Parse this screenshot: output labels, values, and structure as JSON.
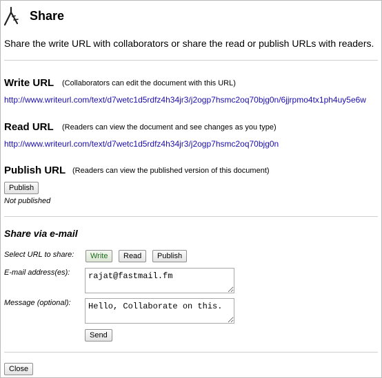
{
  "dialog": {
    "title": "Share",
    "intro": "Share the write URL with collaborators or share the read or publish URLs with readers."
  },
  "write": {
    "heading": "Write URL",
    "note": "(Collaborators can edit the document with this URL)",
    "url": "http://www.writeurl.com/text/d7wetc1d5rdfz4h34jr3/j2ogp7hsmc2oq70bjg0n/6jjrpmo4tx1ph4uy5e6w"
  },
  "read": {
    "heading": "Read URL",
    "note": "(Readers can view the document and see changes as you type)",
    "url": "http://www.writeurl.com/text/d7wetc1d5rdfz4h34jr3/j2ogp7hsmc2oq70bjg0n"
  },
  "publish": {
    "heading": "Publish URL",
    "note": "(Readers can view the published version of this document)",
    "button": "Publish",
    "status": "Not published"
  },
  "email": {
    "heading": "Share via e-mail",
    "select_label": "Select URL to share:",
    "options": [
      "Write",
      "Read",
      "Publish"
    ],
    "selected": "Write",
    "address_label": "E-mail address(es):",
    "address_value": "rajat@fastmail.fm",
    "message_label": "Message (optional):",
    "message_value": "Hello, Collaborate on this.",
    "send_button": "Send"
  },
  "footer": {
    "close_button": "Close"
  },
  "colors": {
    "link": "#1a0dab",
    "selected_option_text": "#1e6b1e"
  }
}
